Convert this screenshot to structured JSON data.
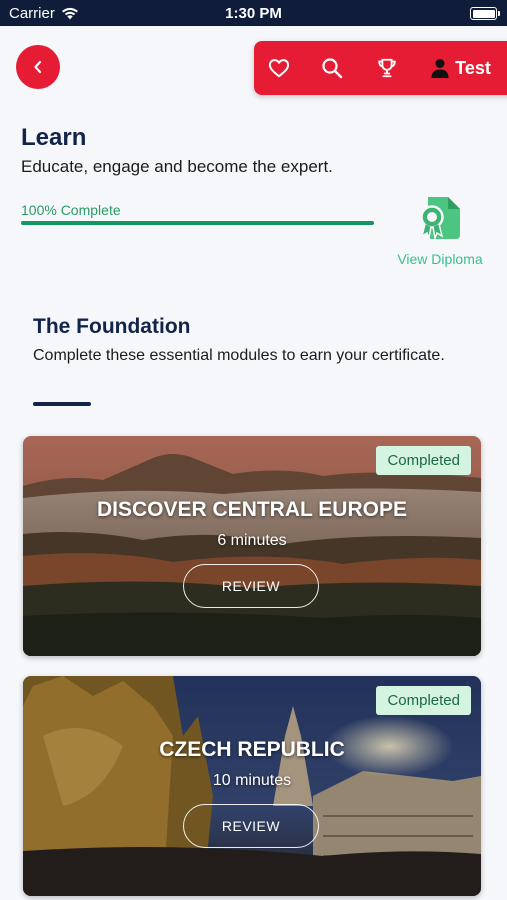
{
  "status_bar": {
    "carrier": "Carrier",
    "time": "1:30 PM"
  },
  "header": {
    "back_icon": "chevron-left-icon",
    "toolbar": {
      "favorites_icon": "heart-icon",
      "search_icon": "search-icon",
      "achievements_icon": "trophy-icon",
      "user_icon": "user-icon",
      "user_label": "Test"
    },
    "accent_color": "#e51c33"
  },
  "learn": {
    "title": "Learn",
    "subtitle": "Educate, engage and become the expert.",
    "progress_label": "100% Complete",
    "progress": 1.0,
    "diploma_icon": "diploma-certificate-icon",
    "diploma_link": "View Diploma"
  },
  "foundation": {
    "title": "The Foundation",
    "description": "Complete these essential modules to earn your certificate."
  },
  "modules": [
    {
      "title": "DISCOVER CENTRAL EUROPE",
      "duration": "6 minutes",
      "badge": "Completed",
      "button": "REVIEW"
    },
    {
      "title": "CZECH REPUBLIC",
      "duration": "10 minutes",
      "badge": "Completed",
      "button": "REVIEW"
    }
  ]
}
